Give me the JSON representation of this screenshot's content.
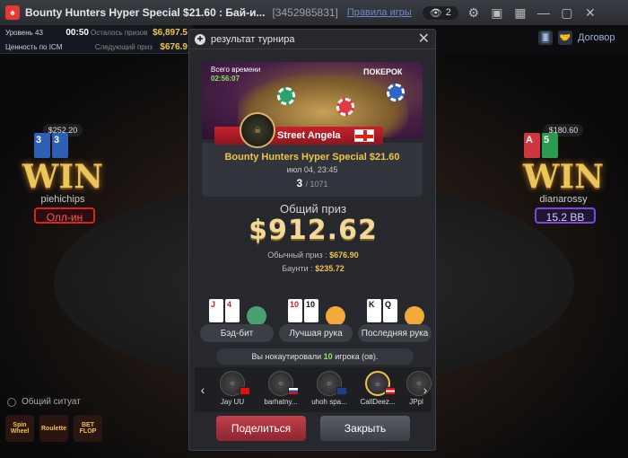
{
  "window": {
    "title": "Bounty Hunters Hyper Special $21.60 : Бай-и...",
    "table_id": "[3452985831]",
    "rules_link": "Правила игры",
    "viewers": "2"
  },
  "infobar": {
    "level_label": "Уровень 43",
    "time": "00:50",
    "remaining_label": "Осталось призов",
    "remaining_value": "$6,897.5",
    "icm_label": "Ценность по ICM",
    "next_prize_label": "Следующий приз",
    "next_prize_value": "$676.9"
  },
  "top_right": {
    "contract_label": "Договор"
  },
  "players": {
    "left": {
      "stack": "$252.20",
      "win": "WIN",
      "name": "piehichips",
      "status": "Олл-ин",
      "cards": [
        "3",
        "3"
      ]
    },
    "right": {
      "stack": "$180.60",
      "win": "WIN",
      "name": "dianarossy",
      "status": "15.2 BB",
      "cards": [
        "A",
        "5"
      ]
    }
  },
  "bottom_left": {
    "common_situation": "Общий ситуат",
    "games": [
      "Spin Wheel",
      "Roulette",
      "BET FLOP"
    ]
  },
  "modal": {
    "title": "результат турнира",
    "banner": {
      "all_time_label": "Всего времени",
      "time": "02:56:07",
      "brand": "ПОКЕРОК"
    },
    "player_name": "Street Angela",
    "tournament_name": "Bounty Hunters Hyper Special $21.60",
    "date": "июл 04, 23:45",
    "place": "3",
    "total_players": "/ 1071",
    "total_prize_label": "Общий приз",
    "total_prize": "$912.62",
    "regular_prize_label": "Обычный приз :",
    "regular_prize": "$676.90",
    "bounty_label": "Баунти :",
    "bounty": "$235.72",
    "hands": [
      {
        "label": "Бэд-бит",
        "cards": [
          "J",
          "4"
        ]
      },
      {
        "label": "Лучшая рука",
        "cards": [
          "10",
          "10"
        ]
      },
      {
        "label": "Последняя рука",
        "cards": [
          "K",
          "Q"
        ]
      }
    ],
    "knockouts_prefix": "Вы нокаутировали ",
    "knockouts_count": "10",
    "knockouts_suffix": " игрока (ов).",
    "knocked_players": [
      {
        "name": "Jay UU"
      },
      {
        "name": "barhatny..."
      },
      {
        "name": "uhoh spa..."
      },
      {
        "name": "CallDeez..."
      },
      {
        "name": "JPpl"
      }
    ],
    "share_button": "Поделиться",
    "close_button": "Закрыть"
  },
  "colors": {
    "accent_gold": "#f0c44c",
    "share_red": "#c0404a",
    "win_gold": "#e9c55c",
    "ko_green": "#8ee26a"
  }
}
